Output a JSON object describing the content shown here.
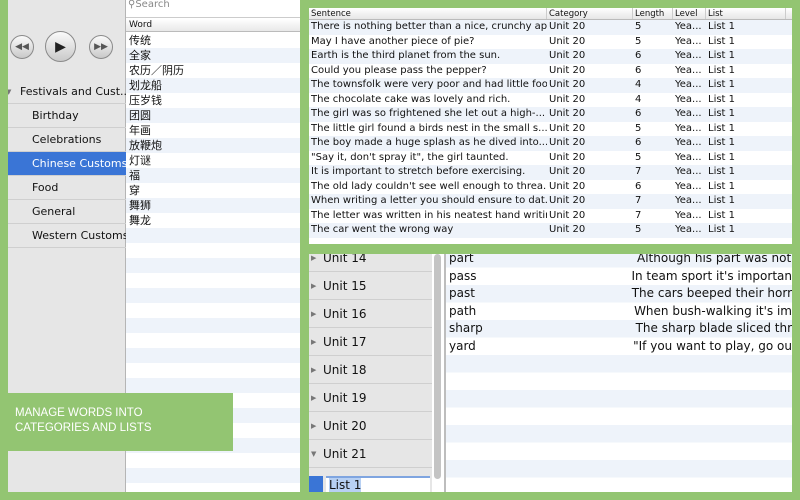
{
  "search": {
    "placeholder": "Search"
  },
  "word_list": {
    "header": "Word",
    "items": [
      "传统",
      "全家",
      "农历／阴历",
      "划龙船",
      "压岁钱",
      "团圆",
      "年画",
      "放鞭炮",
      "灯谜",
      "福",
      "穿",
      "舞狮",
      "舞龙"
    ]
  },
  "categories": {
    "parent": "Festivals and Cust...",
    "items": [
      "Birthday",
      "Celebrations",
      "Chinese Customs",
      "Food",
      "General",
      "Western Customs"
    ],
    "selected": "Chinese Customs"
  },
  "sentences": {
    "columns": [
      "Sentence",
      "Category",
      "Length",
      "Level",
      "List"
    ],
    "rows": [
      [
        "There is nothing better than a nice, crunchy apple.",
        "Unit 20",
        "5",
        "Yea...",
        "List 1"
      ],
      [
        "May I have another piece of pie?",
        "Unit 20",
        "5",
        "Yea...",
        "List 1"
      ],
      [
        "Earth is the third planet from the sun.",
        "Unit 20",
        "6",
        "Yea...",
        "List 1"
      ],
      [
        "Could you please pass the pepper?",
        "Unit 20",
        "6",
        "Yea...",
        "List 1"
      ],
      [
        "The townsfolk were very poor and had little food.",
        "Unit 20",
        "4",
        "Yea...",
        "List 1"
      ],
      [
        "The chocolate cake was lovely and rich.",
        "Unit 20",
        "4",
        "Yea...",
        "List 1"
      ],
      [
        "The girl was so frightened she let out a high-...",
        "Unit 20",
        "6",
        "Yea...",
        "List 1"
      ],
      [
        "The little girl found a birds nest in the small s...",
        "Unit 20",
        "5",
        "Yea...",
        "List 1"
      ],
      [
        "The boy made a huge splash as he dived into...",
        "Unit 20",
        "6",
        "Yea...",
        "List 1"
      ],
      [
        "\"Say it, don't spray it\", the girl taunted.",
        "Unit 20",
        "5",
        "Yea...",
        "List 1"
      ],
      [
        "It is important to stretch before exercising.",
        "Unit 20",
        "7",
        "Yea...",
        "List 1"
      ],
      [
        "The old lady couldn't see well enough to threa...",
        "Unit 20",
        "6",
        "Yea...",
        "List 1"
      ],
      [
        "When writing a letter you should ensure to dat...",
        "Unit 20",
        "7",
        "Yea...",
        "List 1"
      ],
      [
        "The letter was written in his neatest hand writing",
        "Unit 20",
        "7",
        "Yea...",
        "List 1"
      ],
      [
        "The car went the wrong way",
        "Unit 20",
        "5",
        "Yea...",
        "List 1"
      ]
    ]
  },
  "units": {
    "items": [
      "Unit 14",
      "Unit 15",
      "Unit 16",
      "Unit 17",
      "Unit 18",
      "Unit 19",
      "Unit 20",
      "Unit 21"
    ],
    "editing_list": "List 1"
  },
  "unit_words": [
    [
      "part",
      "Although his part was not"
    ],
    [
      "pass",
      "In team sport it's importan"
    ],
    [
      "past",
      "The cars beeped their horr"
    ],
    [
      "path",
      "When bush-walking it's im"
    ],
    [
      "sharp",
      "The sharp blade sliced thr"
    ],
    [
      "yard",
      "\"If you want to play, go ou"
    ]
  ],
  "banner": {
    "line1": "MANAGE WORDS INTO",
    "line2": "CATEGORIES AND LISTS"
  }
}
